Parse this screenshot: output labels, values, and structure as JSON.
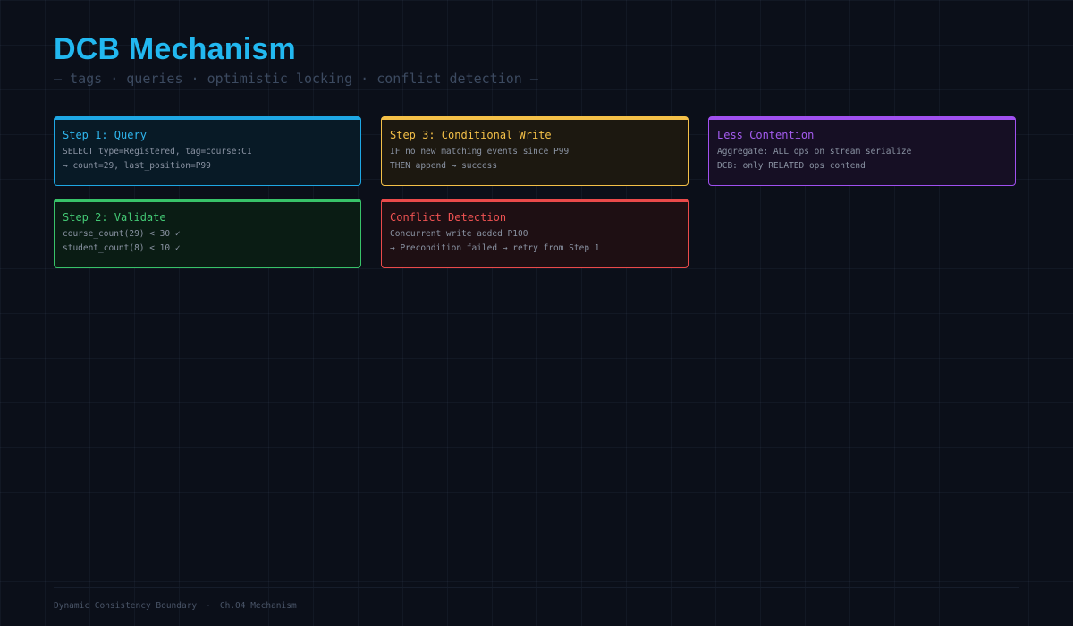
{
  "header": {
    "title": "DCB Mechanism",
    "subtitle": "— tags · queries · optimistic locking · conflict detection —"
  },
  "cards": {
    "step1": {
      "title": "Step 1: Query",
      "lines": [
        "SELECT type=Registered, tag=course:C1",
        "→ count=29, last_position=P99"
      ],
      "color": "#1ea7e4"
    },
    "step2": {
      "title": "Step 2: Validate",
      "lines": [
        "course_count(29) < 30 ✓",
        "student_count(8) < 10 ✓"
      ],
      "color": "#38c269"
    },
    "step3": {
      "title": "Step 3: Conditional Write",
      "lines": [
        "IF no new matching events since P99",
        "THEN append → success"
      ],
      "color": "#f4c048"
    },
    "conflict": {
      "title": "Conflict Detection",
      "lines": [
        "Concurrent write added P100",
        "→ Precondition failed → retry from Step 1"
      ],
      "color": "#ea4a4a"
    },
    "contention": {
      "title": "Less Contention",
      "lines": [
        "Aggregate: ALL ops on stream serialize",
        "DCB: only RELATED ops contend"
      ],
      "color": "#a050f0"
    }
  },
  "footer": {
    "left": "Dynamic Consistency Boundary",
    "separator": "·",
    "right": "Ch.04 Mechanism"
  }
}
